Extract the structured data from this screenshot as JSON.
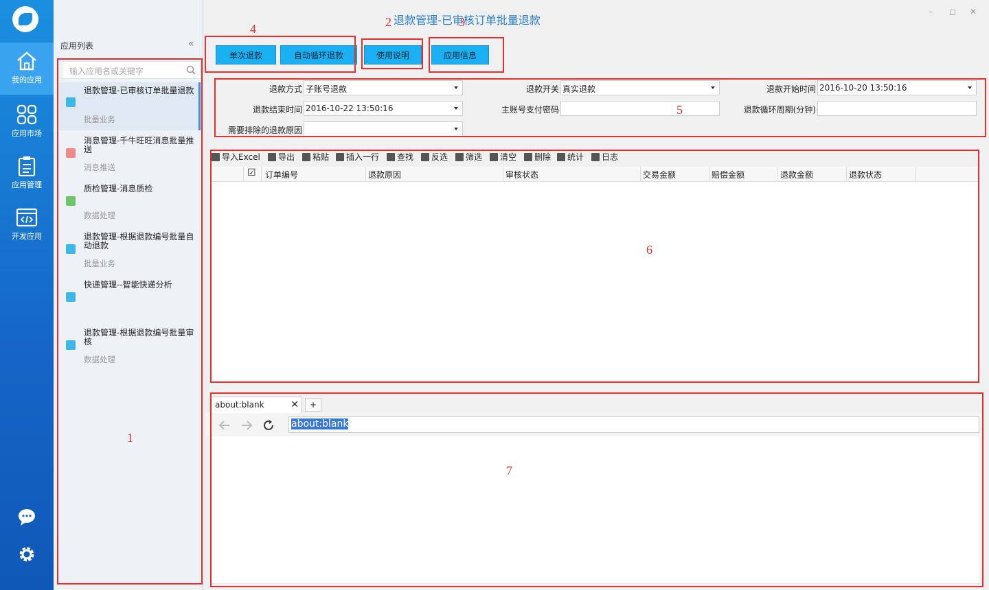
{
  "window": {
    "title": "退款管理-已审核订单批量退款",
    "controls": [
      "–",
      "◻",
      "✕"
    ]
  },
  "nav": {
    "items": [
      {
        "label": "我的应用",
        "icon": "home-icon"
      },
      {
        "label": "应用市场",
        "icon": "grid-icon"
      },
      {
        "label": "应用管理",
        "icon": "clipboard-icon"
      },
      {
        "label": "开发应用",
        "icon": "code-icon"
      }
    ],
    "bottom": [
      "chat-icon",
      "gear-icon"
    ]
  },
  "sidebar": {
    "header": "应用列表",
    "collapse": "«",
    "search_placeholder": "输入应用名或关键字",
    "apps": [
      {
        "title": "退款管理-已审核订单批量退款",
        "category": "批量业务",
        "color": "#3db6e8"
      },
      {
        "title": "消息管理-千牛旺旺消息批量推送",
        "category": "消息推送",
        "color": "#f08a8a"
      },
      {
        "title": "质检管理-消息质检",
        "category": "数据处理",
        "color": "#6cc76a"
      },
      {
        "title": "退款管理-根据退款编号批量自动退款",
        "category": "批量业务",
        "color": "#3db6e8"
      },
      {
        "title": "快递管理--智能快递分析",
        "category": "",
        "color": "#3db6e8"
      },
      {
        "title": "退款管理-根据退款编号批量审核",
        "category": "数据处理",
        "color": "#3db6e8"
      }
    ]
  },
  "toolbar_buttons": {
    "single": "单次退款",
    "auto": "自动循环退款",
    "manual": "使用说明",
    "info": "应用信息"
  },
  "form": {
    "refund_mode_label": "退款方式",
    "refund_mode_value": "子账号退款",
    "refund_switch_label": "退款开关",
    "refund_switch_value": "真实退款",
    "start_time_label": "退款开始时间",
    "start_time_value": "2016-10-20 13:50:16",
    "end_time_label": "退款结束时间",
    "end_time_value": "2016-10-22 13:50:16",
    "main_pwd_label": "主账号支付密码",
    "main_pwd_value": "",
    "cycle_label": "退款循环周期(分钟)",
    "cycle_value": "",
    "exclude_label": "需要排除的退款原因",
    "exclude_value": ""
  },
  "grid_toolbar": [
    "导入Excel",
    "导出",
    "粘贴",
    "插入一行",
    "查找",
    "反选",
    "筛选",
    "清空",
    "删除",
    "统计",
    "日志"
  ],
  "grid": {
    "check": "☑",
    "columns": [
      "订单编号",
      "退款原因",
      "审核状态",
      "交易金额",
      "赔偿金额",
      "退款金额",
      "退款状态"
    ]
  },
  "browser": {
    "tab_title": "about:blank",
    "tab_close": "✕",
    "new_tab": "+",
    "url": "about:blank"
  },
  "annotations": [
    "1",
    "2",
    "3",
    "4",
    "5",
    "6",
    "7"
  ]
}
